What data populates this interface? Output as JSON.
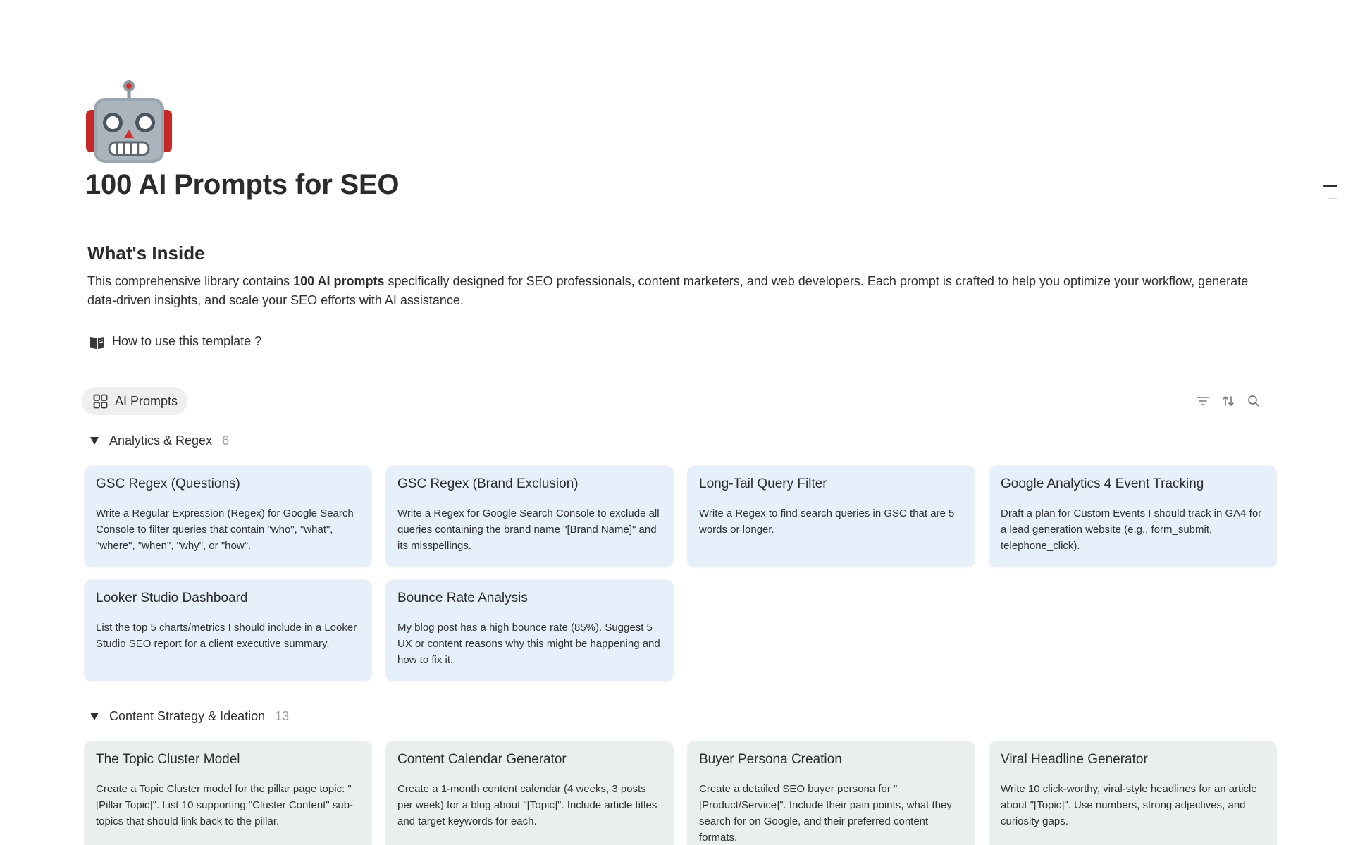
{
  "page": {
    "icon": "robot-emoji",
    "title": "100 AI Prompts for SEO"
  },
  "intro": {
    "heading": "What's Inside",
    "text_before": "This comprehensive library contains ",
    "text_bold": "100 AI prompts",
    "text_after": " specifically designed for SEO professionals, content marketers, and web developers. Each prompt is crafted to help you optimize your workflow, generate data-driven insights, and scale your SEO efforts with AI assistance."
  },
  "howto": {
    "icon": "book-icon",
    "label": "How to use this template ?"
  },
  "view": {
    "tab_icon": "gallery-grid-icon",
    "tab_label": "AI Prompts",
    "toolbar": [
      "filter-icon",
      "sort-icon",
      "search-icon"
    ]
  },
  "groups": [
    {
      "name": "Analytics & Regex",
      "count": "6",
      "color": "#e5f0fb",
      "cards": [
        {
          "title": "GSC Regex (Questions)",
          "body": "Write a Regular Expression (Regex) for Google Search Console to filter queries that contain \"who\", \"what\", \"where\", \"when\", \"why\", or \"how\"."
        },
        {
          "title": "GSC Regex (Brand Exclusion)",
          "body": "Write a Regex for Google Search Console to exclude all queries containing the brand name \"[Brand Name]\" and its misspellings."
        },
        {
          "title": "Long-Tail Query Filter",
          "body": "Write a Regex to find search queries in GSC that are 5 words or longer."
        },
        {
          "title": "Google Analytics 4 Event Tracking",
          "body": "Draft a plan for Custom Events I should track in GA4 for a lead generation website (e.g., form_submit, telephone_click)."
        },
        {
          "title": "Looker Studio Dashboard",
          "body": "List the top 5 charts/metrics I should include in a Looker Studio SEO report for a client executive summary."
        },
        {
          "title": "Bounce Rate Analysis",
          "body": "My blog post has a high bounce rate (85%). Suggest 5 UX or content reasons why this might be happening and how to fix it."
        }
      ]
    },
    {
      "name": "Content Strategy & Ideation",
      "count": "13",
      "color": "#e9f0ec",
      "cards": [
        {
          "title": "The Topic Cluster Model",
          "body": "Create a Topic Cluster model for the pillar page topic: \"[Pillar Topic]\". List 10 supporting \"Cluster Content\" sub-topics that should link back to the pillar."
        },
        {
          "title": "Content Calendar Generator",
          "body": "Create a 1-month content calendar (4 weeks, 3 posts per week) for a blog about \"[Topic]\". Include article titles and target keywords for each."
        },
        {
          "title": "Buyer Persona Creation",
          "body": "Create a detailed SEO buyer persona for \"[Product/Service]\". Include their pain points, what they search for on Google, and their preferred content formats."
        },
        {
          "title": "Viral Headline Generator",
          "body": "Write 10 click-worthy, viral-style headlines for an article about \"[Topic]\". Use numbers, strong adjectives, and curiosity gaps."
        }
      ]
    }
  ]
}
